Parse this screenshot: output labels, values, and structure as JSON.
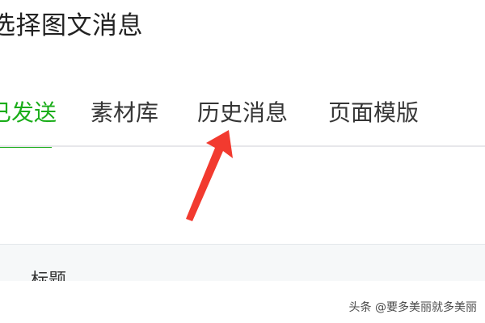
{
  "dialog": {
    "title": "选择图文消息"
  },
  "tabs": [
    {
      "label": "已发送",
      "active": true
    },
    {
      "label": "素材库",
      "active": false
    },
    {
      "label": "历史消息",
      "active": false
    },
    {
      "label": "页面模版",
      "active": false
    }
  ],
  "table": {
    "header_title": "标题"
  },
  "watermark": "头条 @要多美丽就多美丽",
  "colors": {
    "accent": "#1aad19",
    "annotation_arrow": "#f23a2f",
    "divider": "#e7e7eb",
    "header_bg": "#f6f8f9"
  },
  "icons": {
    "annotation": "red-arrow-icon"
  }
}
